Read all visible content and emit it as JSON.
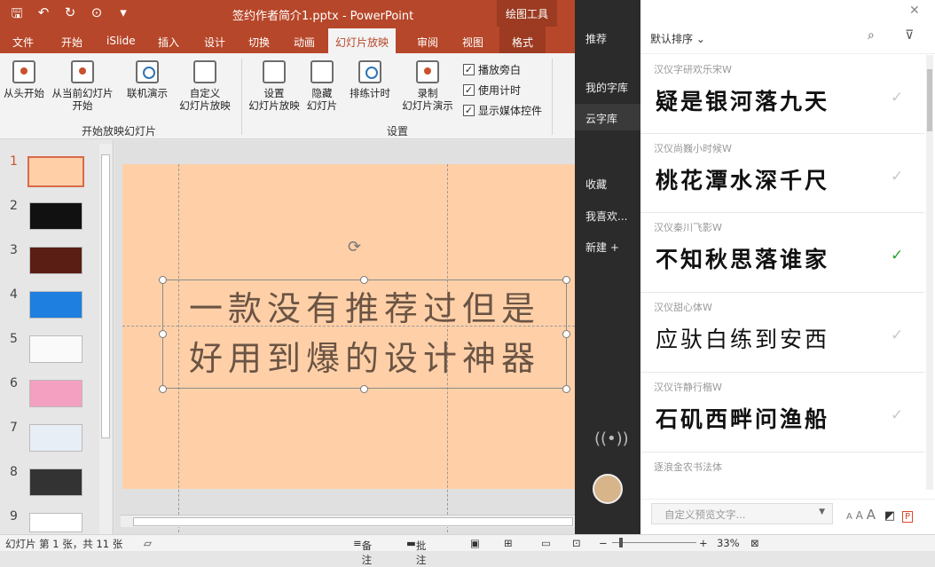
{
  "titlebar": {
    "doc_title": "签约作者简介1.pptx  -  PowerPoint",
    "context_tool": "绘图工具",
    "qa_icons": [
      "save-icon",
      "undo-icon",
      "redo-icon",
      "slideshow-icon",
      "more-icon"
    ]
  },
  "tabs": [
    "文件",
    "开始",
    "iSlide",
    "插入",
    "设计",
    "切换",
    "动画",
    "幻灯片放映",
    "审阅",
    "视图",
    "格式"
  ],
  "ribbon": {
    "start_group": {
      "from_beginning": [
        "从头开始"
      ],
      "from_current": [
        "从当前幻灯片",
        "开始"
      ],
      "online": [
        "联机演示"
      ],
      "custom": [
        "自定义",
        "幻灯片放映"
      ],
      "label": "开始放映幻灯片"
    },
    "setup_group": {
      "setup": [
        "设置",
        "幻灯片放映"
      ],
      "hide": [
        "隐藏",
        "幻灯片"
      ],
      "rehearse": [
        "排练计时"
      ],
      "record": [
        "录制",
        "幻灯片演示"
      ],
      "label": "设置"
    },
    "checkboxes": [
      "播放旁白",
      "使用计时",
      "显示媒体控件"
    ]
  },
  "slides": [
    "1",
    "2",
    "3",
    "4",
    "5",
    "6",
    "7",
    "8",
    "9"
  ],
  "slide": {
    "line1": "一款没有推荐过但是",
    "line2": "好用到爆的设计神器"
  },
  "statusbar": {
    "slide_info": "幻灯片 第 1 张，共 11 张",
    "notes": "备注",
    "comments": "批注",
    "zoom": "33%"
  },
  "sidebar": {
    "recommend": "推荐",
    "my_fonts": "我的字库",
    "cloud_fonts": "云字库",
    "favorites": "收藏",
    "likes": "我喜欢...",
    "new": "新建 +"
  },
  "fontpanel": {
    "sort_label": "默认排序",
    "fonts": [
      {
        "name": "汉仪字研欢乐宋W",
        "sample": "疑是银河落九天",
        "selected": false
      },
      {
        "name": "汉仪尚巍小时候W",
        "sample": "桃花潭水深千尺",
        "selected": false
      },
      {
        "name": "汉仪秦川飞影W",
        "sample": "不知秋思落谁家",
        "selected": true
      },
      {
        "name": "汉仪甜心体W",
        "sample": "应驮白练到安西",
        "selected": false
      },
      {
        "name": "汉仪许静行楷W",
        "sample": "石矶西畔问渔船",
        "selected": false
      },
      {
        "name": "逐浪金农书法体",
        "sample": "",
        "selected": false
      }
    ],
    "preview_placeholder": "自定义预览文字..."
  },
  "colors": {
    "accent": "#b7472a",
    "slide_bg": "#ffd0a8",
    "sidebar_bg": "#2b2b2b",
    "check_on": "#2aa52a"
  }
}
